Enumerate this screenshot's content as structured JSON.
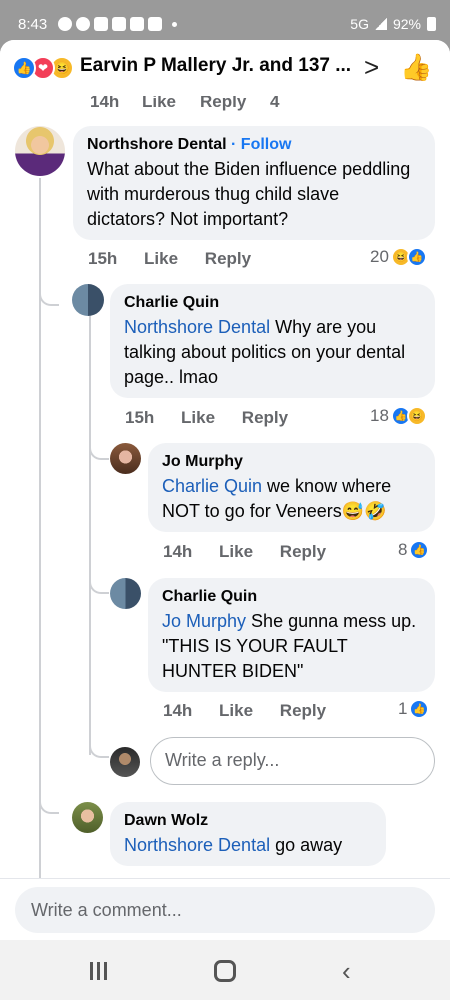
{
  "status_bar": {
    "time": "8:43",
    "network": "5G",
    "battery": "92%"
  },
  "header": {
    "title": "Earvin P Mallery Jr. and 137 ...",
    "chevron": ">",
    "thumb": "👍"
  },
  "partial_above": {
    "time": "14h",
    "like": "Like",
    "reply": "Reply",
    "count": "4"
  },
  "comments": [
    {
      "author": "Northshore Dental",
      "follow": "· Follow",
      "text": "What about the Biden influence peddling with murderous  thug child slave dictators? Not important?",
      "time": "15h",
      "like": "Like",
      "reply": "Reply",
      "count": "20"
    },
    {
      "author": "Charlie Quin",
      "tag": "Northshore Dental",
      "text": " Why are you talking about politics on your dental page.. lmao",
      "time": "15h",
      "like": "Like",
      "reply": "Reply",
      "count": "18"
    },
    {
      "author": "Jo Murphy",
      "tag": "Charlie Quin",
      "text": " we know where NOT to go for Veneers😅🤣",
      "time": "14h",
      "like": "Like",
      "reply": "Reply",
      "count": "8"
    },
    {
      "author": "Charlie Quin",
      "tag": "Jo Murphy",
      "text": " She gunna mess up. \"THIS IS YOUR FAULT HUNTER BIDEN\"",
      "time": "14h",
      "like": "Like",
      "reply": "Reply",
      "count": "1"
    },
    {
      "author": "Dawn Wolz",
      "tag": "Northshore Dental",
      "text": " go away"
    }
  ],
  "reply_box": {
    "placeholder": "Write a reply..."
  },
  "composer": {
    "placeholder": "Write a comment..."
  },
  "icons": {
    "like": "👍",
    "love": "❤",
    "haha": "😆",
    "nav_recent": "recent-apps-icon",
    "nav_home": "home-icon",
    "nav_back": "‹"
  },
  "colors": {
    "accent": "#1877f2",
    "tag": "#1c5fb9",
    "bubble": "#f0f2f5",
    "meta": "#65676b"
  }
}
